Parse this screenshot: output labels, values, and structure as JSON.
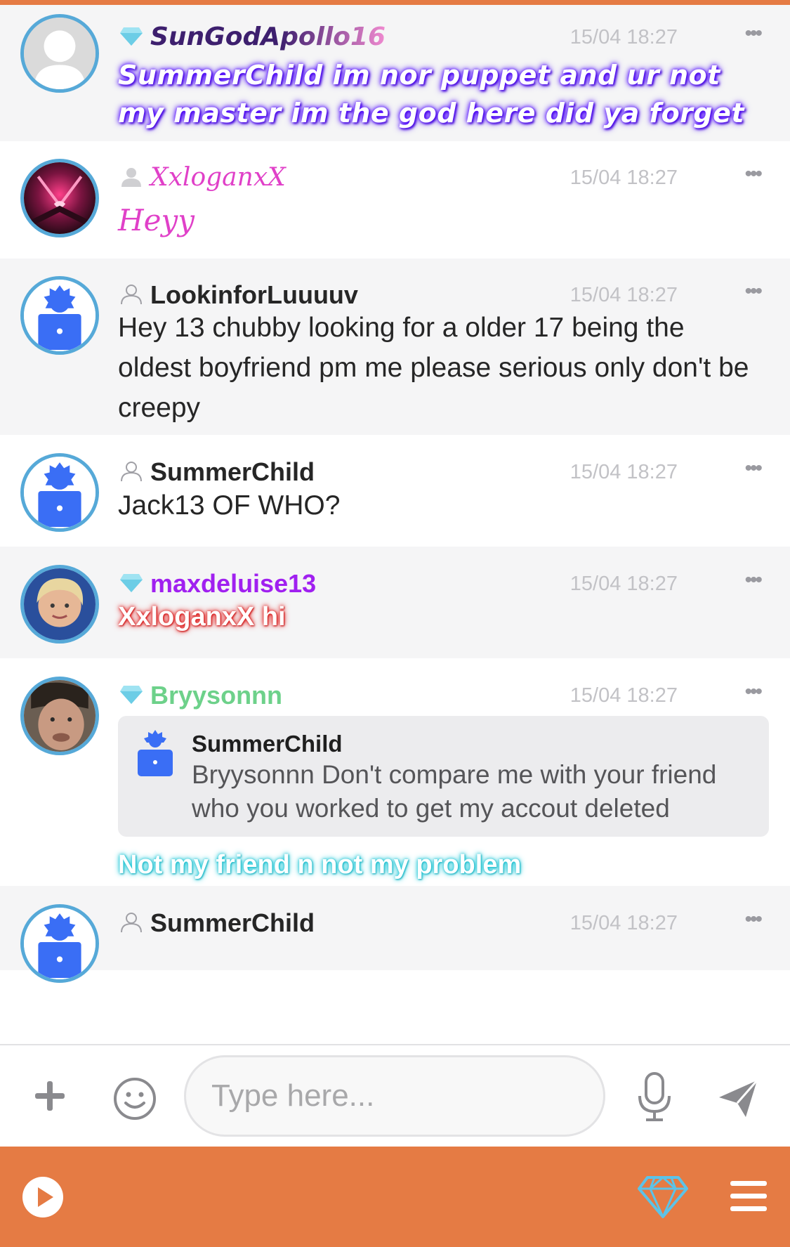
{
  "colors": {
    "accent": "#e57b44",
    "avatar_ring": "#56a9d8",
    "time_text": "#c2c2c6",
    "sungod_name": "#3d1f6e",
    "xxlogan_name": "#e040c8",
    "max_name": "#a020f0",
    "bryysonn_name": "#6dd18a"
  },
  "messages": [
    {
      "username": "SunGodApollo16",
      "time": "15/04 18:27",
      "text": "SummerChild im nor puppet and ur not my master im the god here did ya forget",
      "rank_icon": "diamond-icon",
      "avatar": "default-avatar-icon"
    },
    {
      "username": "XxloganxX",
      "time": "15/04 18:27",
      "text": "Heyy",
      "rank_icon": "user-filled-icon",
      "avatar": "photo-avatar"
    },
    {
      "username": "LookinforLuuuuv",
      "time": "15/04 18:27",
      "text": "Hey 13 chubby looking for a older 17 being the oldest boyfriend pm me please serious only don't be creepy",
      "rank_icon": "user-outline-icon",
      "avatar": "robot-avatar-icon"
    },
    {
      "username": "SummerChild",
      "time": "15/04 18:27",
      "text": "Jack13 OF WHO?",
      "rank_icon": "user-outline-icon",
      "avatar": "robot-avatar-icon"
    },
    {
      "username": "maxdeluise13",
      "time": "15/04 18:27",
      "text": "XxloganxX hi",
      "rank_icon": "diamond-icon",
      "avatar": "photo-avatar"
    },
    {
      "username": "Bryysonnn",
      "time": "15/04 18:27",
      "quote": {
        "username": "SummerChild",
        "text": "Bryysonnn Don't compare me with your friend who you worked to get my accout deleted"
      },
      "text": "Not my friend n not my problem",
      "rank_icon": "diamond-icon",
      "avatar": "photo-avatar"
    },
    {
      "username": "SummerChild",
      "time": "15/04 18:27",
      "rank_icon": "user-outline-icon",
      "avatar": "robot-avatar-icon"
    }
  ],
  "composer": {
    "placeholder": "Type here...",
    "icons": [
      "plus-icon",
      "emoji-icon",
      "microphone-icon",
      "send-icon"
    ]
  },
  "bottom_bar": {
    "icons": [
      "play-icon",
      "diamond-icon",
      "menu-icon"
    ]
  }
}
